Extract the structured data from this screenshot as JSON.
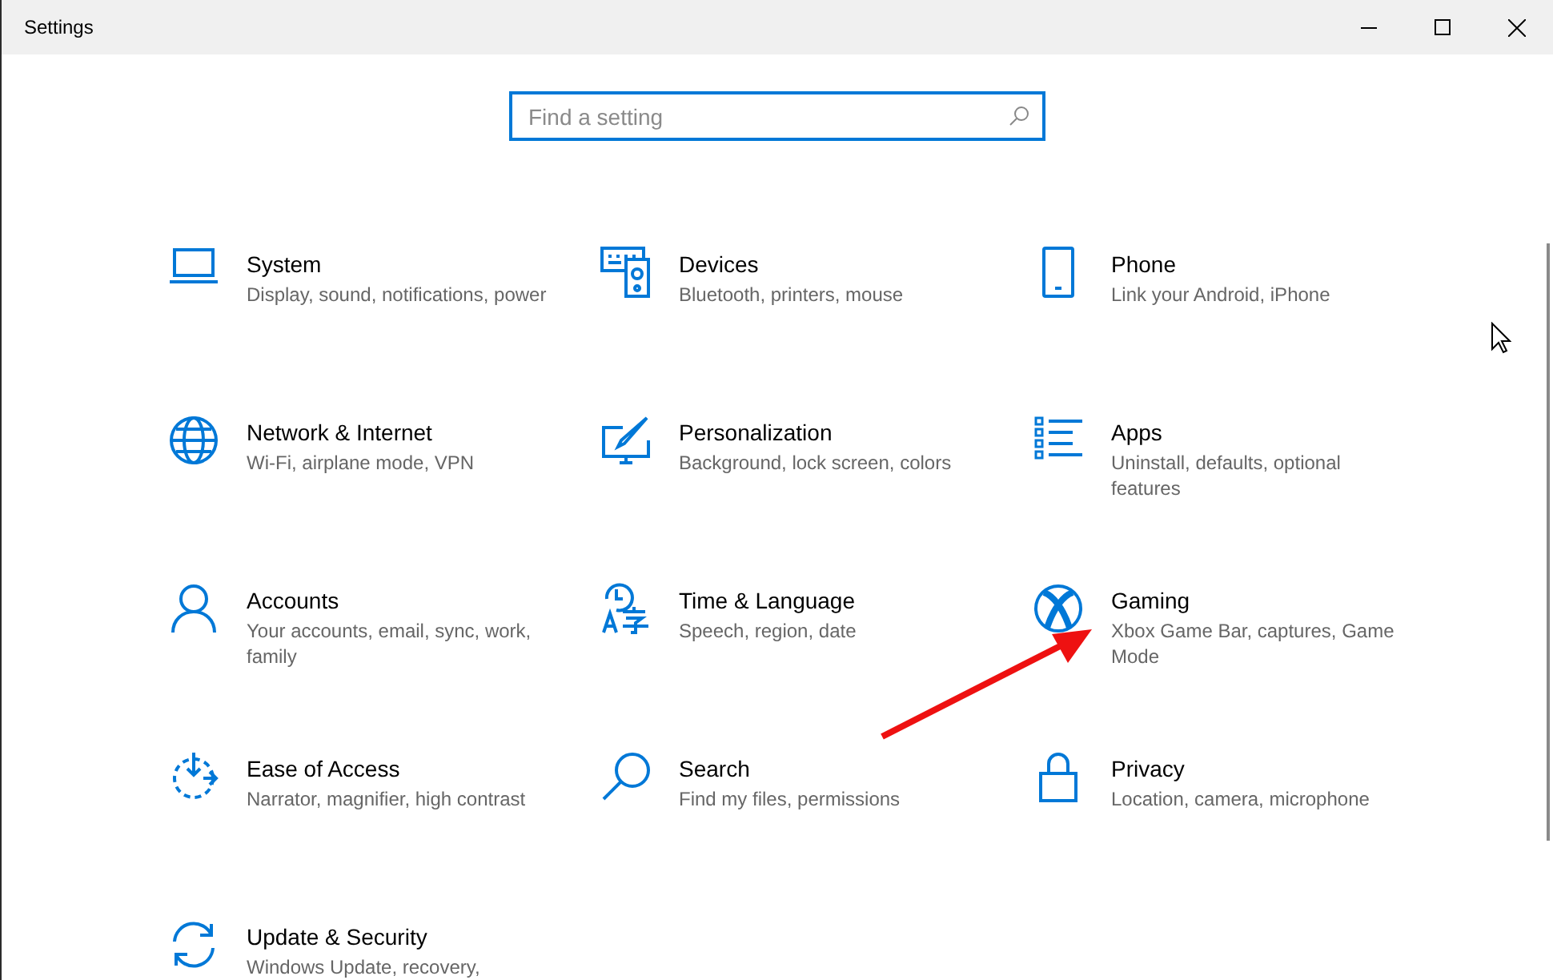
{
  "window": {
    "title": "Settings"
  },
  "search": {
    "placeholder": "Find a setting"
  },
  "categories": [
    {
      "kind": "laptop",
      "title": "System",
      "description": "Display, sound, notifications, power"
    },
    {
      "kind": "devices",
      "title": "Devices",
      "description": "Bluetooth, printers, mouse"
    },
    {
      "kind": "phone",
      "title": "Phone",
      "description": "Link your Android, iPhone"
    },
    {
      "kind": "globe",
      "title": "Network & Internet",
      "description": "Wi-Fi, airplane mode, VPN"
    },
    {
      "kind": "paint",
      "title": "Personalization",
      "description": "Background, lock screen, colors"
    },
    {
      "kind": "list",
      "title": "Apps",
      "description": "Uninstall, defaults, optional features"
    },
    {
      "kind": "person",
      "title": "Accounts",
      "description": "Your accounts, email, sync, work, family"
    },
    {
      "kind": "language",
      "title": "Time & Language",
      "description": "Speech, region, date"
    },
    {
      "kind": "xbox",
      "title": "Gaming",
      "description": "Xbox Game Bar, captures, Game Mode"
    },
    {
      "kind": "ease",
      "title": "Ease of Access",
      "description": "Narrator, magnifier, high contrast"
    },
    {
      "kind": "search",
      "title": "Search",
      "description": "Find my files, permissions"
    },
    {
      "kind": "lock",
      "title": "Privacy",
      "description": "Location, camera, microphone"
    },
    {
      "kind": "sync",
      "title": "Update & Security",
      "description": "Windows Update, recovery,"
    }
  ]
}
